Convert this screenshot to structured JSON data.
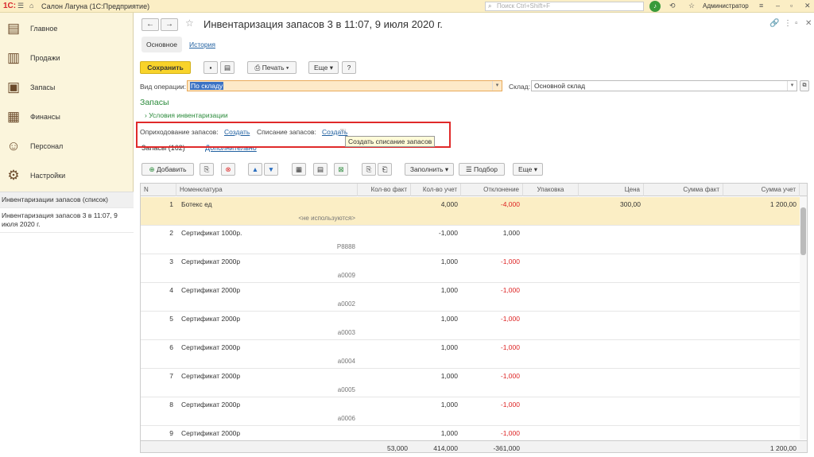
{
  "app": {
    "logo": "1С:",
    "title": "Салон Лагуна  (1С:Предприятие)",
    "search_placeholder": "Поиск Ctrl+Shift+F",
    "user": "Администратор"
  },
  "sidebar": {
    "items": [
      {
        "label": "Главное",
        "icon": "home-icon"
      },
      {
        "label": "Продажи",
        "icon": "sales-icon"
      },
      {
        "label": "Запасы",
        "icon": "stock-icon"
      },
      {
        "label": "Финансы",
        "icon": "wallet-icon"
      },
      {
        "label": "Персонал",
        "icon": "people-icon"
      },
      {
        "label": "Настройки",
        "icon": "gear-icon"
      }
    ],
    "open_windows": [
      "Инвентаризации запасов (список)",
      "Инвентаризация запасов 3 в 11:07, 9 июля 2020 г."
    ]
  },
  "document": {
    "title": "Инвентаризация запасов 3 в 11:07, 9 июля 2020 г.",
    "tabs": [
      "Основное",
      "История"
    ],
    "toolbar": {
      "save": "Сохранить",
      "print": "Печать",
      "more": "Еще",
      "help": "?"
    },
    "operation_label": "Вид операции:",
    "operation_value": "По складу",
    "warehouse_label": "Склад:",
    "warehouse_value": "Основной склад",
    "section_title": "Запасы",
    "conditions_link": "Условия инвентаризации",
    "receipt_label": "Оприходование запасов:",
    "receipt_link": "Создать",
    "writeoff_label": "Списание запасов:",
    "writeoff_link": "Создать",
    "tooltip": "Создать списание запасов",
    "subtabs": [
      "Запасы (162)",
      "Дополнительно"
    ]
  },
  "table_toolbar": {
    "add": "Добавить",
    "fill": "Заполнить",
    "select": "Подбор",
    "more": "Еще"
  },
  "table": {
    "headers": [
      "N",
      "Номенклатура",
      "Кол-во факт",
      "Кол-во учет",
      "Отклонение",
      "Упаковка",
      "Цена",
      "Сумма факт",
      "Сумма учет"
    ],
    "rows": [
      {
        "n": "1",
        "name": "Ботекс ед",
        "sub": "<не используются>",
        "fact": "",
        "acc": "4,000",
        "dev": "-4,000",
        "price": "300,00",
        "sum_fact": "",
        "sum_acc": "1 200,00"
      },
      {
        "n": "2",
        "name": "Сертификат 1000р.",
        "sub": "P8888",
        "fact": "",
        "acc": "-1,000",
        "dev": "1,000",
        "price": "",
        "sum_fact": "",
        "sum_acc": ""
      },
      {
        "n": "3",
        "name": "Сертификат 2000р",
        "sub": "a0009",
        "fact": "",
        "acc": "1,000",
        "dev": "-1,000",
        "price": "",
        "sum_fact": "",
        "sum_acc": ""
      },
      {
        "n": "4",
        "name": "Сертификат 2000р",
        "sub": "a0002",
        "fact": "",
        "acc": "1,000",
        "dev": "-1,000",
        "price": "",
        "sum_fact": "",
        "sum_acc": ""
      },
      {
        "n": "5",
        "name": "Сертификат 2000р",
        "sub": "a0003",
        "fact": "",
        "acc": "1,000",
        "dev": "-1,000",
        "price": "",
        "sum_fact": "",
        "sum_acc": ""
      },
      {
        "n": "6",
        "name": "Сертификат 2000р",
        "sub": "a0004",
        "fact": "",
        "acc": "1,000",
        "dev": "-1,000",
        "price": "",
        "sum_fact": "",
        "sum_acc": ""
      },
      {
        "n": "7",
        "name": "Сертификат 2000р",
        "sub": "a0005",
        "fact": "",
        "acc": "1,000",
        "dev": "-1,000",
        "price": "",
        "sum_fact": "",
        "sum_acc": ""
      },
      {
        "n": "8",
        "name": "Сертификат 2000р",
        "sub": "a0006",
        "fact": "",
        "acc": "1,000",
        "dev": "-1,000",
        "price": "",
        "sum_fact": "",
        "sum_acc": ""
      },
      {
        "n": "9",
        "name": "Сертификат 2000р",
        "sub": "",
        "fact": "",
        "acc": "1,000",
        "dev": "-1,000",
        "price": "",
        "sum_fact": "",
        "sum_acc": ""
      }
    ],
    "totals": {
      "fact": "53,000",
      "acc": "414,000",
      "dev": "-361,000",
      "sum_acc": "1 200,00"
    }
  }
}
